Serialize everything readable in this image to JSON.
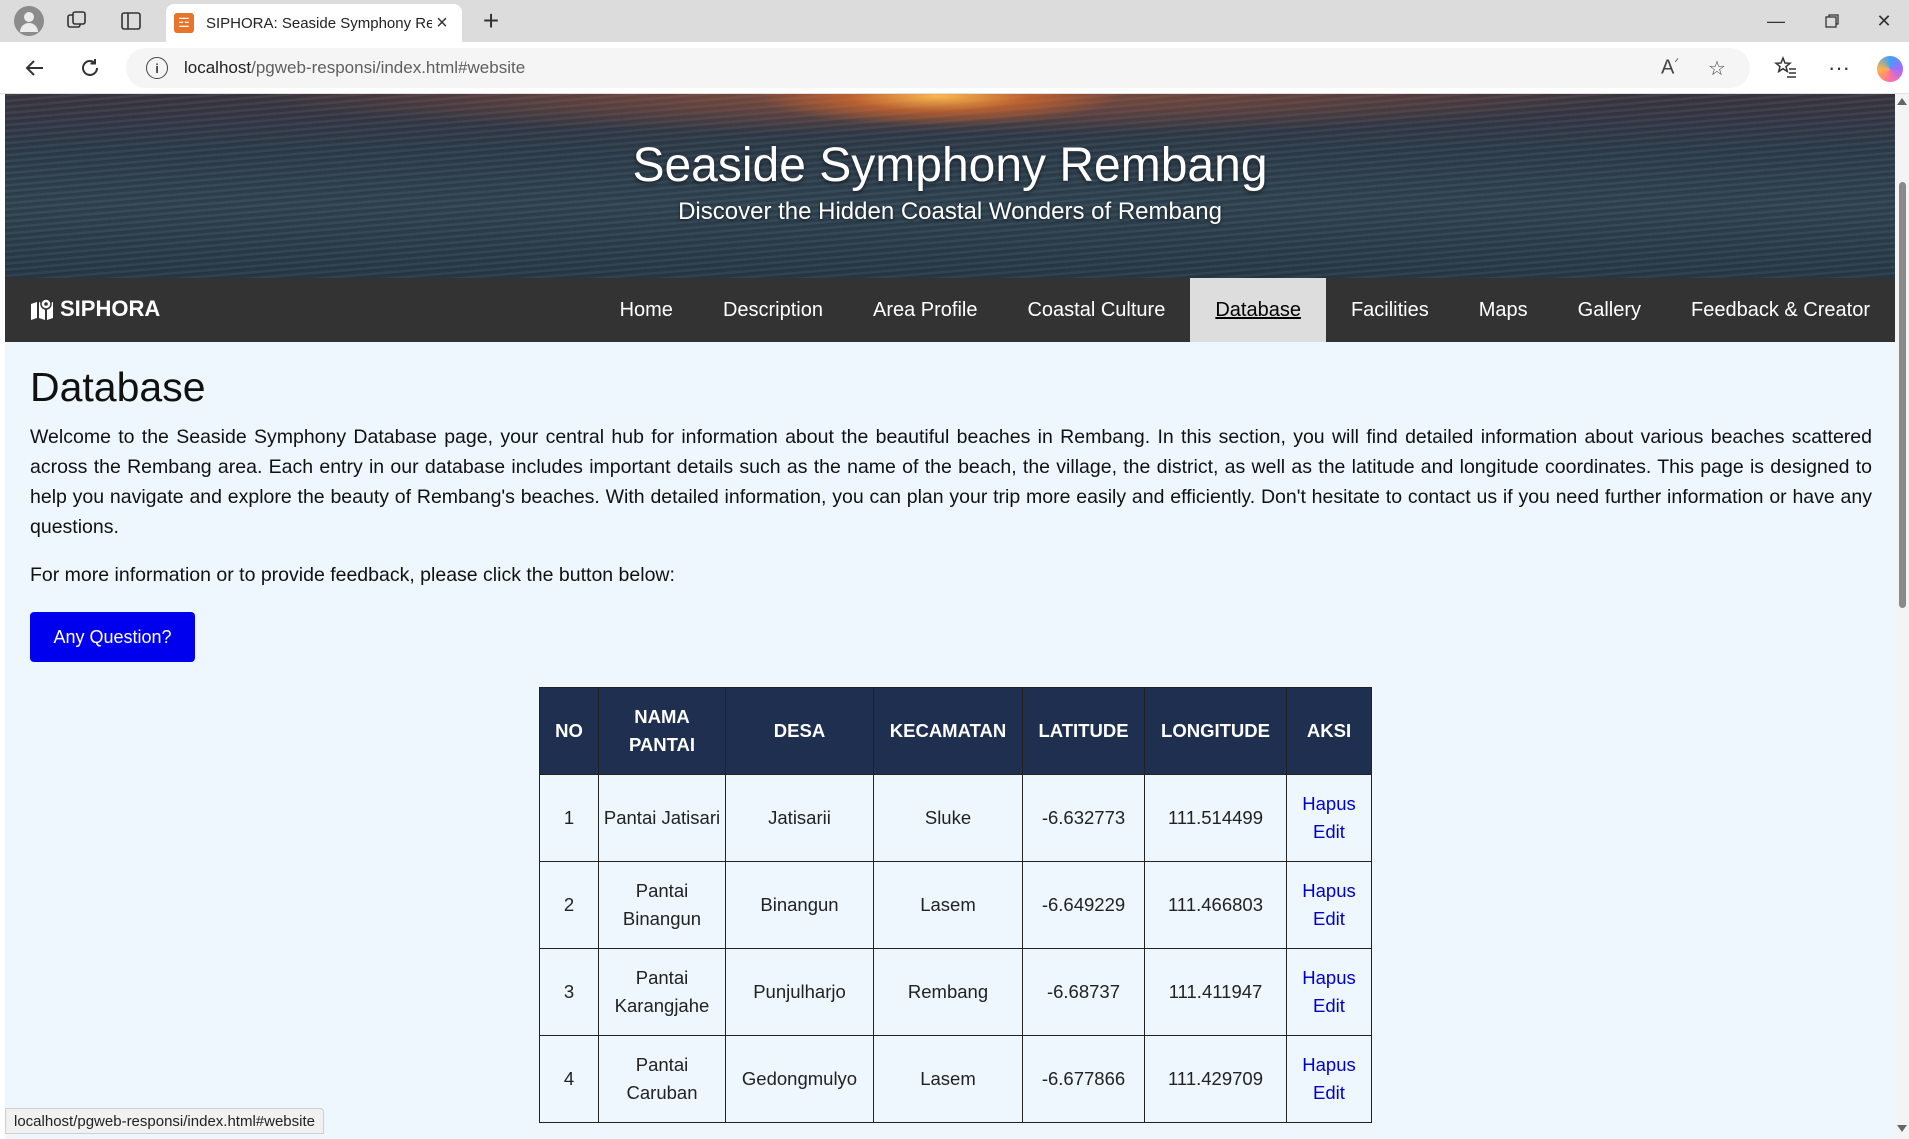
{
  "browser": {
    "tab_title": "SIPHORA: Seaside Symphony Rem",
    "url_host": "localhost",
    "url_path": "/pgweb-responsi/index.html#website",
    "status_url": "localhost/pgweb-responsi/index.html#website"
  },
  "hero": {
    "title": "Seaside Symphony Rembang",
    "subtitle": "Discover the Hidden Coastal Wonders of Rembang"
  },
  "nav": {
    "brand": "SIPHORA",
    "items": [
      "Home",
      "Description",
      "Area Profile",
      "Coastal Culture",
      "Database",
      "Facilities",
      "Maps",
      "Gallery",
      "Feedback & Creator"
    ],
    "active": "Database"
  },
  "page": {
    "title": "Database",
    "intro": "Welcome to the Seaside Symphony Database page, your central hub for information about the beautiful beaches in Rembang. In this section, you will find detailed information about various beaches scattered across the Rembang area. Each entry in our database includes important details such as the name of the beach, the village, the district, as well as the latitude and longitude coordinates. This page is designed to help you navigate and explore the beauty of Rembang's beaches. With detailed information, you can plan your trip more easily and efficiently. Don't hesitate to contact us if you need further information or have any questions.",
    "prompt": "For more information or to provide feedback, please click the button below:",
    "button": "Any Question?"
  },
  "table": {
    "headers": [
      "NO",
      "NAMA PANTAI",
      "DESA",
      "KECAMATAN",
      "LATITUDE",
      "LONGITUDE",
      "AKSI"
    ],
    "rows": [
      {
        "no": "1",
        "nama": "Pantai Jatisari",
        "desa": "Jatisarii",
        "kecamatan": "Sluke",
        "lat": "-6.632773",
        "lon": "111.514499",
        "hapus": "Hapus",
        "edit": "Edit"
      },
      {
        "no": "2",
        "nama": "Pantai Binangun",
        "desa": "Binangun",
        "kecamatan": "Lasem",
        "lat": "-6.649229",
        "lon": "111.466803",
        "hapus": "Hapus",
        "edit": "Edit"
      },
      {
        "no": "3",
        "nama": "Pantai Karangjahe",
        "desa": "Punjulharjo",
        "kecamatan": "Rembang",
        "lat": "-6.68737",
        "lon": "111.411947",
        "hapus": "Hapus",
        "edit": "Edit"
      },
      {
        "no": "4",
        "nama": "Pantai Caruban",
        "desa": "Gedongmulyo",
        "kecamatan": "Lasem",
        "lat": "-6.677866",
        "lon": "111.429709",
        "hapus": "Hapus",
        "edit": "Edit"
      }
    ]
  },
  "colors": {
    "nav_bg": "#333333",
    "table_header": "#1e2f50",
    "button": "#0000ee",
    "link": "#0000cc",
    "page_bg": "#eef7fd"
  },
  "icons": [
    "profile-icon",
    "workspaces-icon",
    "tab-actions-icon",
    "close-icon",
    "plus-icon",
    "minimize-icon",
    "restore-icon",
    "back-icon",
    "reload-icon",
    "info-icon",
    "read-aloud-icon",
    "star-icon",
    "favorites-icon",
    "more-icon",
    "copilot-icon",
    "map-marker-icon"
  ]
}
